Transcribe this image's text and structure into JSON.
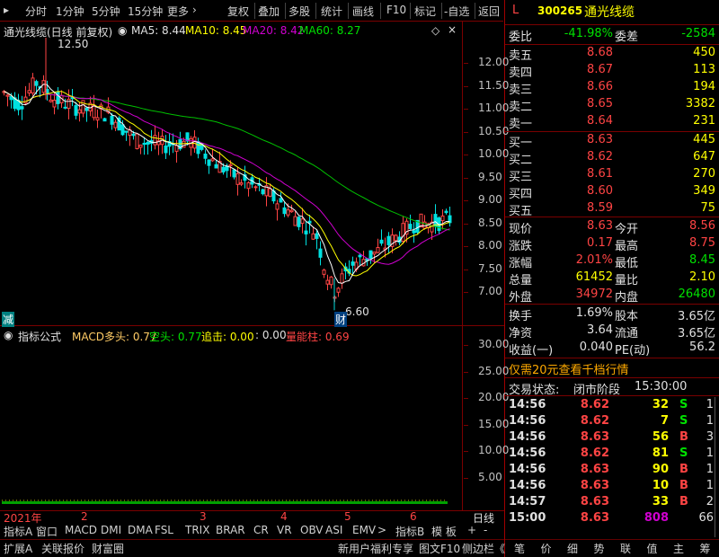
{
  "toolbar": {
    "left": [
      "分时",
      "1分钟",
      "5分钟",
      "15分钟",
      "更多",
      "›"
    ],
    "right": [
      "复权",
      "叠加",
      "多股",
      "统计",
      "画线",
      "F10",
      "标记",
      "-自选",
      "返回"
    ]
  },
  "stock": {
    "market": "L",
    "code": "300265",
    "name": "通光线缆"
  },
  "chart_header": {
    "name": "通光线缆(日线 前复权)",
    "ma5": "MA5: 8.44",
    "ma10": "MA10: 8.45",
    "ma20": "MA20: 8.42",
    "ma60": "MA60: 8.27",
    "high_mark": "12.50",
    "low_mark": "6.60",
    "left_badge": "减",
    "cai_badge": "财"
  },
  "price_axis": [
    "12.00",
    "11.50",
    "11.00",
    "10.50",
    "10.00",
    "9.50",
    "9.00",
    "8.50",
    "8.00",
    "7.50",
    "7.00"
  ],
  "indicator": {
    "name": "指标公式",
    "macd_long": "MACD多头: 0.77",
    "kong": "空头: 0.77",
    "zhuiji": "追击: 0.00",
    "zero": ": 0.00",
    "liangneng": "量能柱: 0.69",
    "axis": [
      "30.00",
      "25.00",
      "20.00",
      "15.00",
      "10.00",
      "5.00"
    ]
  },
  "time_axis": {
    "labels": [
      "2021年",
      "2",
      "3",
      "4",
      "5",
      "6"
    ],
    "period": "日线"
  },
  "func_tabs": [
    "指标A",
    "窗口",
    "MACD",
    "DMI",
    "DMA",
    "FSL",
    "TRIX",
    "BRAR",
    "CR",
    "VR",
    "OBV",
    "ASI",
    "EMV",
    ">",
    "指标B",
    "模 板",
    "+",
    "-"
  ],
  "bottom_tabs": [
    "扩展A",
    "关联报价",
    "财富圈"
  ],
  "bottom_right": [
    "新用户福利专享",
    "图文F10",
    "侧边栏《"
  ],
  "right_tabs": [
    "笔",
    "价",
    "细",
    "势",
    "联",
    "值",
    "主",
    "筹"
  ],
  "weibi": {
    "label": "委比",
    "value": "-41.98%",
    "label2": "委差",
    "value2": "-2584"
  },
  "sells": [
    {
      "label": "卖五",
      "price": "8.68",
      "vol": "450"
    },
    {
      "label": "卖四",
      "price": "8.67",
      "vol": "113"
    },
    {
      "label": "卖三",
      "price": "8.66",
      "vol": "194"
    },
    {
      "label": "卖二",
      "price": "8.65",
      "vol": "3382"
    },
    {
      "label": "卖一",
      "price": "8.64",
      "vol": "231"
    }
  ],
  "buys": [
    {
      "label": "买一",
      "price": "8.63",
      "vol": "445"
    },
    {
      "label": "买二",
      "price": "8.62",
      "vol": "647"
    },
    {
      "label": "买三",
      "price": "8.61",
      "vol": "270"
    },
    {
      "label": "买四",
      "price": "8.60",
      "vol": "349"
    },
    {
      "label": "买五",
      "price": "8.59",
      "vol": "75"
    }
  ],
  "quote": [
    {
      "l1": "现价",
      "v1": "8.63",
      "l2": "今开",
      "v2": "8.56"
    },
    {
      "l1": "涨跌",
      "v1": "0.17",
      "l2": "最高",
      "v2": "8.75"
    },
    {
      "l1": "涨幅",
      "v1": "2.01%",
      "l2": "最低",
      "v2": "8.45"
    },
    {
      "l1": "总量",
      "v1": "61452",
      "l2": "量比",
      "v2": "2.10"
    },
    {
      "l1": "外盘",
      "v1": "34972",
      "l2": "内盘",
      "v2": "26480"
    }
  ],
  "stats": [
    {
      "l1": "换手",
      "v1": "1.69%",
      "l2": "股本",
      "v2": "3.65亿"
    },
    {
      "l1": "净资",
      "v1": "3.64",
      "l2": "流通",
      "v2": "3.65亿"
    },
    {
      "l1": "收益(一)",
      "v1": "0.040",
      "l2": "PE(动)",
      "v2": "56.2"
    }
  ],
  "promo": "仅需20元查看千档行情",
  "trade_status": {
    "label": "交易状态:",
    "value": "闭市阶段",
    "time": "15:30:00"
  },
  "ticks": [
    {
      "t": "14:56",
      "p": "8.62",
      "v": "32",
      "bs": "S",
      "n": "1"
    },
    {
      "t": "14:56",
      "p": "8.62",
      "v": "7",
      "bs": "S",
      "n": "1"
    },
    {
      "t": "14:56",
      "p": "8.63",
      "v": "56",
      "bs": "B",
      "n": "3"
    },
    {
      "t": "14:56",
      "p": "8.62",
      "v": "81",
      "bs": "S",
      "n": "1"
    },
    {
      "t": "14:56",
      "p": "8.63",
      "v": "90",
      "bs": "B",
      "n": "1"
    },
    {
      "t": "14:56",
      "p": "8.63",
      "v": "10",
      "bs": "B",
      "n": "1"
    },
    {
      "t": "14:57",
      "p": "8.63",
      "v": "33",
      "bs": "B",
      "n": "2"
    },
    {
      "t": "15:00",
      "p": "8.63",
      "v": "808",
      "bs": "",
      "n": "66"
    }
  ],
  "colors": {
    "up": "#ff4444",
    "down": "#00e0e0",
    "ma5": "#ffffff",
    "ma10": "#ffff00",
    "ma20": "#d000d0",
    "ma60": "#00c000"
  }
}
